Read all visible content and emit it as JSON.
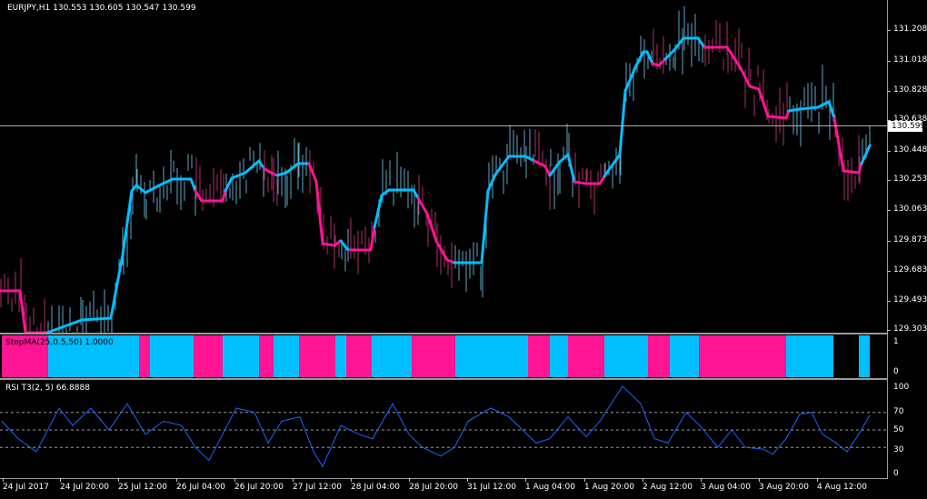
{
  "main": {
    "title": "EURJPY,H1  130.553 130.605 130.547 130.599",
    "price_scale": [
      "131.208",
      "131.018",
      "130.828",
      "130.638",
      "130.448",
      "130.253",
      "130.063",
      "129.873",
      "129.683",
      "129.493",
      "129.303"
    ],
    "current_price": "130.599",
    "colors": {
      "up": "#00bfff",
      "down": "#ff1493",
      "bars_up": "#5fa8c8",
      "bars_down": "#b0306a"
    }
  },
  "stepma": {
    "title": "StepMA(25,0.5,50) 1.0000",
    "scale": [
      "1",
      "0"
    ],
    "segments": [
      "down",
      "up",
      "down",
      "up",
      "down",
      "up",
      "down",
      "up",
      "down",
      "up",
      "down",
      "up",
      "down",
      "up",
      "down",
      "up",
      "down",
      "up",
      "down",
      "up",
      "down",
      "up"
    ]
  },
  "rsi": {
    "title": "RSI T3(2, 5) 66.8888",
    "scale": [
      "100",
      "70",
      "50",
      "30",
      "0"
    ],
    "levels": [
      70,
      50,
      30
    ],
    "color": "#1e64ff"
  },
  "time_axis": [
    "24 Jul 2017",
    "24 Jul 20:00",
    "25 Jul 12:00",
    "26 Jul 04:00",
    "26 Jul 20:00",
    "27 Jul 12:00",
    "28 Jul 04:00",
    "28 Jul 20:00",
    "31 Jul 12:00",
    "1 Aug 04:00",
    "1 Aug 20:00",
    "2 Aug 12:00",
    "3 Aug 04:00",
    "3 Aug 20:00",
    "4 Aug 12:00"
  ]
}
